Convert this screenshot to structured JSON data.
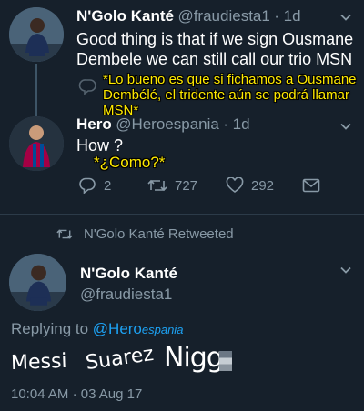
{
  "tweet1": {
    "name": "N'Golo Kanté",
    "handle": "@fraudiesta1",
    "time": "· 1d",
    "text_line1": "Good thing is that if we sign Ousmane",
    "text_line2": "Dembele we can still call our trio MSN",
    "translation_line1": "*Lo bueno es que si fichamos a Ousmane",
    "translation_line2": "Dembélé, el tridente aún se podrá llamar",
    "translation_line3": "MSN*"
  },
  "tweet2": {
    "name": "Hero",
    "handle": "@Heroespania",
    "time": "· 1d",
    "text": "How ?",
    "translation": "*¿Como?*",
    "replies": "2",
    "retweets": "727",
    "likes": "292"
  },
  "retweet_notice": "N'Golo Kanté Retweeted",
  "tweet3": {
    "name": "N'Golo Kanté",
    "handle": "@fraudiesta1",
    "replying_prefix": "Replying to ",
    "replying_handle": "@Hero",
    "replying_handle_suffix": "espania",
    "word1": "Messi",
    "word2": "Suarez",
    "word3": "Nigg",
    "time": "10:04 AM",
    "date": "· 03 Aug 17"
  },
  "colors": {
    "background": "#16202b",
    "secondary_text": "#8899a6",
    "link": "#1da1f2",
    "caption": "#ffea00"
  },
  "icons": [
    "chevron-down-icon",
    "reply-icon",
    "retweet-icon",
    "like-icon",
    "share-icon"
  ]
}
